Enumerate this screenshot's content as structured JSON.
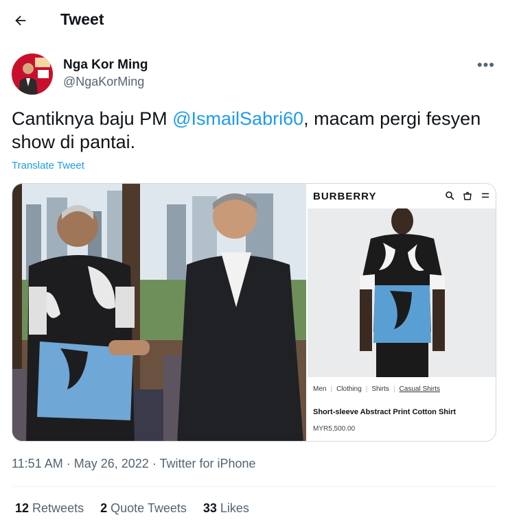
{
  "header": {
    "title": "Tweet"
  },
  "author": {
    "name": "Nga Kor Ming",
    "handle": "@NgaKorMing"
  },
  "tweet": {
    "text_before": "Cantiknya baju PM ",
    "mention": "@IsmailSabri60",
    "text_after": ", macam pergi fesyen show di pantai.",
    "translate_label": "Translate Tweet"
  },
  "media": {
    "brand": "BURBERRY",
    "breadcrumbs": [
      "Men",
      "Clothing",
      "Shirts",
      "Casual Shirts"
    ],
    "product_name": "Short-sleeve Abstract Print Cotton Shirt",
    "product_price": "MYR5,500.00"
  },
  "meta": {
    "time": "11:51 AM",
    "date": "May 26, 2022",
    "source": "Twitter for iPhone"
  },
  "stats": {
    "retweets_count": "12",
    "retweets_label": "Retweets",
    "quotes_count": "2",
    "quotes_label": "Quote Tweets",
    "likes_count": "33",
    "likes_label": "Likes"
  },
  "colors": {
    "link": "#1d9bf0",
    "secondary_text": "#536471",
    "primary_text": "#0f1419"
  }
}
